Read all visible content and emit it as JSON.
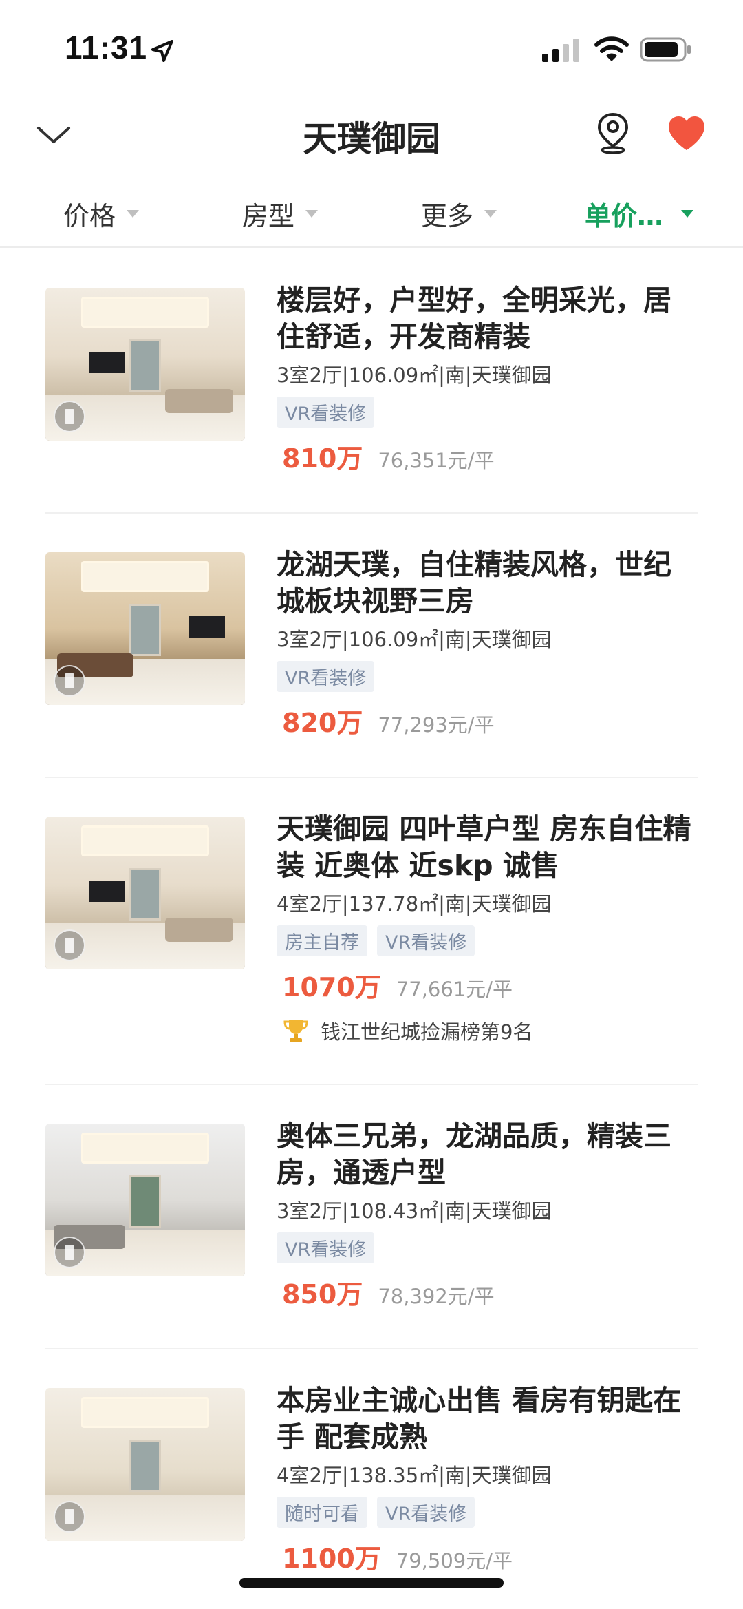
{
  "status_bar": {
    "time": "11:31"
  },
  "header": {
    "title": "天璞御园"
  },
  "filters": [
    {
      "label": "价格",
      "active": false
    },
    {
      "label": "房型",
      "active": false
    },
    {
      "label": "更多",
      "active": false
    },
    {
      "label": "单价…",
      "active": true
    }
  ],
  "listings": [
    {
      "title": "楼层好，户型好，全明采光，居住舒适，开发商精装",
      "specs": "3室2厅|106.09㎡|南|天璞御园",
      "tags": [
        "VR看装修"
      ],
      "price": "810万",
      "unit_price": "76,351元/平"
    },
    {
      "title": "龙湖天璞，自住精装风格，世纪城板块视野三房",
      "specs": "3室2厅|106.09㎡|南|天璞御园",
      "tags": [
        "VR看装修"
      ],
      "price": "820万",
      "unit_price": "77,293元/平"
    },
    {
      "title": "天璞御园 四叶草户型 房东自住精装 近奥体 近skp 诚售",
      "specs": "4室2厅|137.78㎡|南|天璞御园",
      "tags": [
        "房主自荐",
        "VR看装修"
      ],
      "price": "1070万",
      "unit_price": "77,661元/平",
      "ranking": "钱江世纪城捡漏榜第9名"
    },
    {
      "title": "奥体三兄弟，龙湖品质，精装三房，通透户型",
      "specs": "3室2厅|108.43㎡|南|天璞御园",
      "tags": [
        "VR看装修"
      ],
      "price": "850万",
      "unit_price": "78,392元/平"
    },
    {
      "title": "本房业主诚心出售 看房有钥匙在手 配套成熟",
      "specs": "4室2厅|138.35㎡|南|天璞御园",
      "tags": [
        "随时可看",
        "VR看装修"
      ],
      "price": "1100万",
      "unit_price": "79,509元/平"
    }
  ],
  "colors": {
    "accent": "#17a05d",
    "price": "#ec5b3f",
    "heart": "#f2553f",
    "tag_text": "#7b8aa2"
  }
}
